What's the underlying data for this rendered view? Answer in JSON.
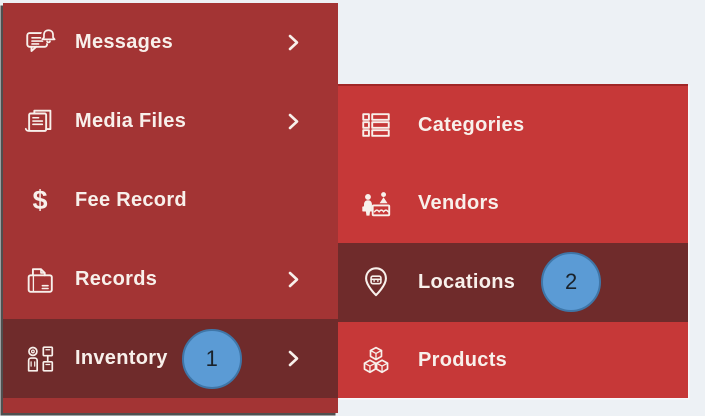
{
  "colors": {
    "canvas_bg": "#EDF1F5",
    "sidebar_bg": "#A33434",
    "submenu_bg": "#C63838",
    "highlight_bg": "#6F2B2B",
    "badge_fill": "#5B9BD5",
    "badge_border": "#3F76A8",
    "text": "#F8F0EB"
  },
  "annotations": {
    "step_1": "1",
    "step_2": "2"
  },
  "sidebar": {
    "items": [
      {
        "label": "Messages",
        "icon": "messages-icon",
        "has_submenu_arrow": true,
        "highlighted": false
      },
      {
        "label": "Media Files",
        "icon": "media-files-icon",
        "has_submenu_arrow": true,
        "highlighted": false
      },
      {
        "label": "Fee Record",
        "icon": "dollar-icon",
        "icon_glyph": "$",
        "has_submenu_arrow": false,
        "highlighted": false
      },
      {
        "label": "Records",
        "icon": "records-icon",
        "has_submenu_arrow": true,
        "highlighted": false
      },
      {
        "label": "Inventory",
        "icon": "inventory-icon",
        "has_submenu_arrow": true,
        "highlighted": true,
        "badge": "1"
      }
    ]
  },
  "submenu": {
    "items": [
      {
        "label": "Categories",
        "icon": "categories-icon",
        "highlighted": false
      },
      {
        "label": "Vendors",
        "icon": "vendors-icon",
        "highlighted": false
      },
      {
        "label": "Locations",
        "icon": "location-pin-icon",
        "highlighted": true,
        "badge": "2"
      },
      {
        "label": "Products",
        "icon": "products-icon",
        "highlighted": false
      }
    ]
  }
}
